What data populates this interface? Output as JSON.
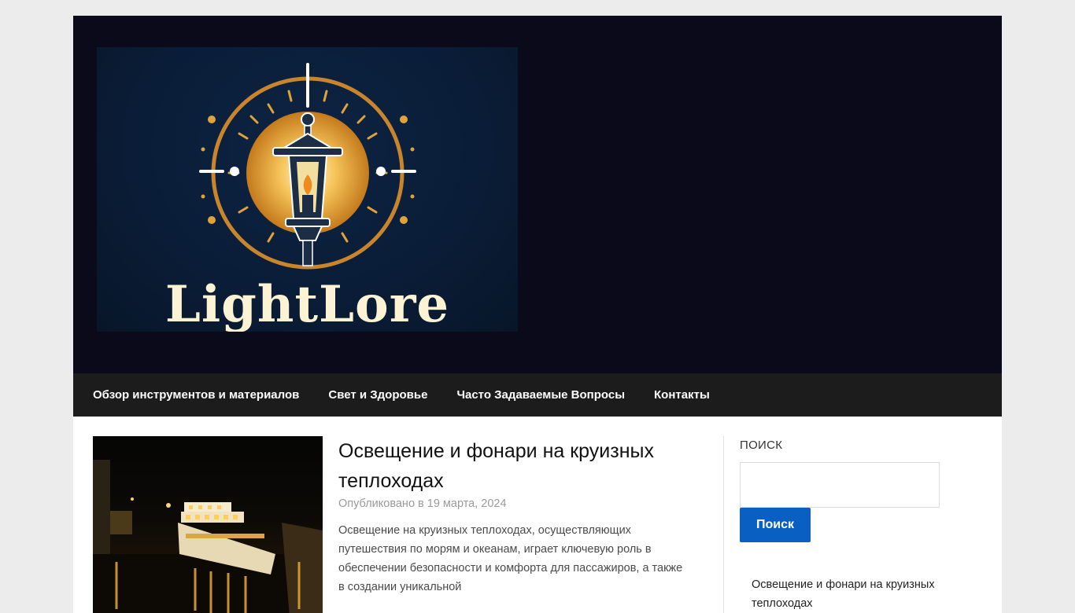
{
  "header": {
    "logo_text": "LightLore"
  },
  "nav": {
    "items": [
      {
        "label": "Обзор инструментов и материалов"
      },
      {
        "label": "Свет и Здоровье"
      },
      {
        "label": "Часто Задаваемые Вопросы"
      },
      {
        "label": "Контакты"
      }
    ]
  },
  "post": {
    "title": "Освещение и фонари на круизных теплоходах",
    "meta": "Опубликовано в 19 марта, 2024",
    "excerpt": "Освещение на круизных теплоходах, осуществляющих путешествия по морям и океанам, играет ключевую роль в обеспечении безопасности и комфорта для пассажиров, а также в создании уникальной"
  },
  "sidebar": {
    "search_title": "ПОИСК",
    "search_placeholder": "",
    "search_button": "Поиск",
    "recent_post": "Освещение и фонари на круизных теплоходах"
  },
  "colors": {
    "header_bg": "#0a0a1a",
    "nav_bg": "#1c1c1c",
    "accent": "#0a5fc2",
    "logo_gold": "#d9902e"
  }
}
